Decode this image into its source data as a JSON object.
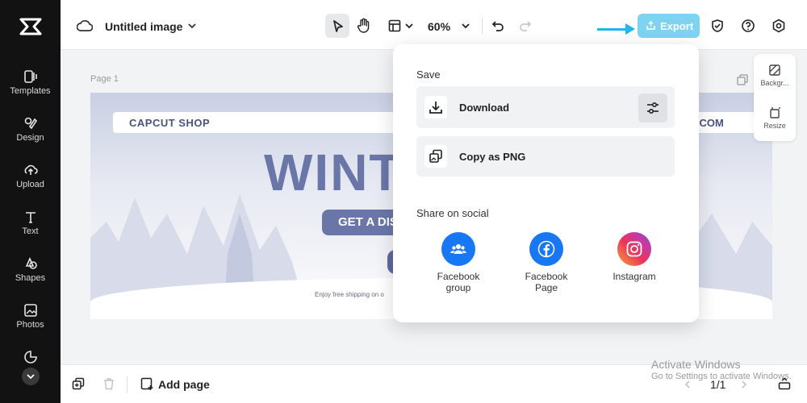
{
  "sidebar": {
    "items": [
      {
        "label": "Templates",
        "icon": "templates-icon"
      },
      {
        "label": "Design",
        "icon": "design-icon"
      },
      {
        "label": "Upload",
        "icon": "upload-icon"
      },
      {
        "label": "Text",
        "icon": "text-icon"
      },
      {
        "label": "Shapes",
        "icon": "shapes-icon"
      },
      {
        "label": "Photos",
        "icon": "photos-icon"
      }
    ]
  },
  "topbar": {
    "title": "Untitled image",
    "zoom": "60%",
    "export_label": "Export"
  },
  "canvas": {
    "page_label": "Page 1",
    "shop_text": "CAPCUT SHOP",
    "shop_text_right": "UT.COM",
    "headline": "WINT",
    "discount": "GET A DIS",
    "shipping": "Enjoy free shipping on o"
  },
  "right_panel": {
    "background_label": "Backgr...",
    "resize_label": "Resize"
  },
  "bottombar": {
    "add_page": "Add page",
    "page_count": "1/1"
  },
  "windows_notice": {
    "title": "Activate Windows",
    "subtitle": "Go to Settings to activate Windows."
  },
  "export_menu": {
    "save_label": "Save",
    "download_label": "Download",
    "copy_label": "Copy as PNG",
    "share_label": "Share on social",
    "social": [
      {
        "label_line1": "Facebook",
        "label_line2": "group"
      },
      {
        "label_line1": "Facebook",
        "label_line2": "Page"
      },
      {
        "label_line1": "Instagram",
        "label_line2": ""
      }
    ]
  },
  "colors": {
    "sidebar_bg": "#121212",
    "export_button": "#7dd3f0",
    "arrow": "#21b6e8",
    "facebook": "#1877f2",
    "winter_text": "#6a76a8"
  }
}
